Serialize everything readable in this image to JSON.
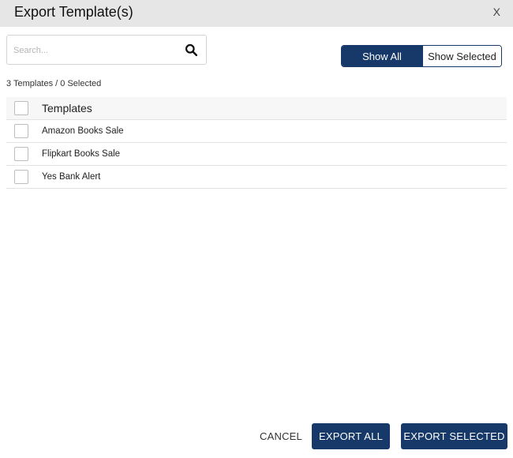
{
  "dialog": {
    "title": "Export Template(s)",
    "close_label": "X"
  },
  "search": {
    "placeholder": "Search...",
    "value": ""
  },
  "filter": {
    "show_all": "Show All",
    "show_selected": "Show Selected",
    "active": "show_all"
  },
  "summary": {
    "count_text": "3 Templates / 0 Selected"
  },
  "table": {
    "header": "Templates",
    "rows": [
      {
        "name": "Amazon Books Sale",
        "checked": false
      },
      {
        "name": "Flipkart Books Sale",
        "checked": false
      },
      {
        "name": "Yes Bank Alert",
        "checked": false
      }
    ]
  },
  "footer": {
    "cancel": "CANCEL",
    "export_all": "EXPORT ALL",
    "export_selected": "EXPORT SELECTED"
  },
  "colors": {
    "primary": "#17396a",
    "header_bg": "#e6e6e6"
  },
  "icons": {
    "search": "search-icon",
    "close": "close-icon"
  }
}
